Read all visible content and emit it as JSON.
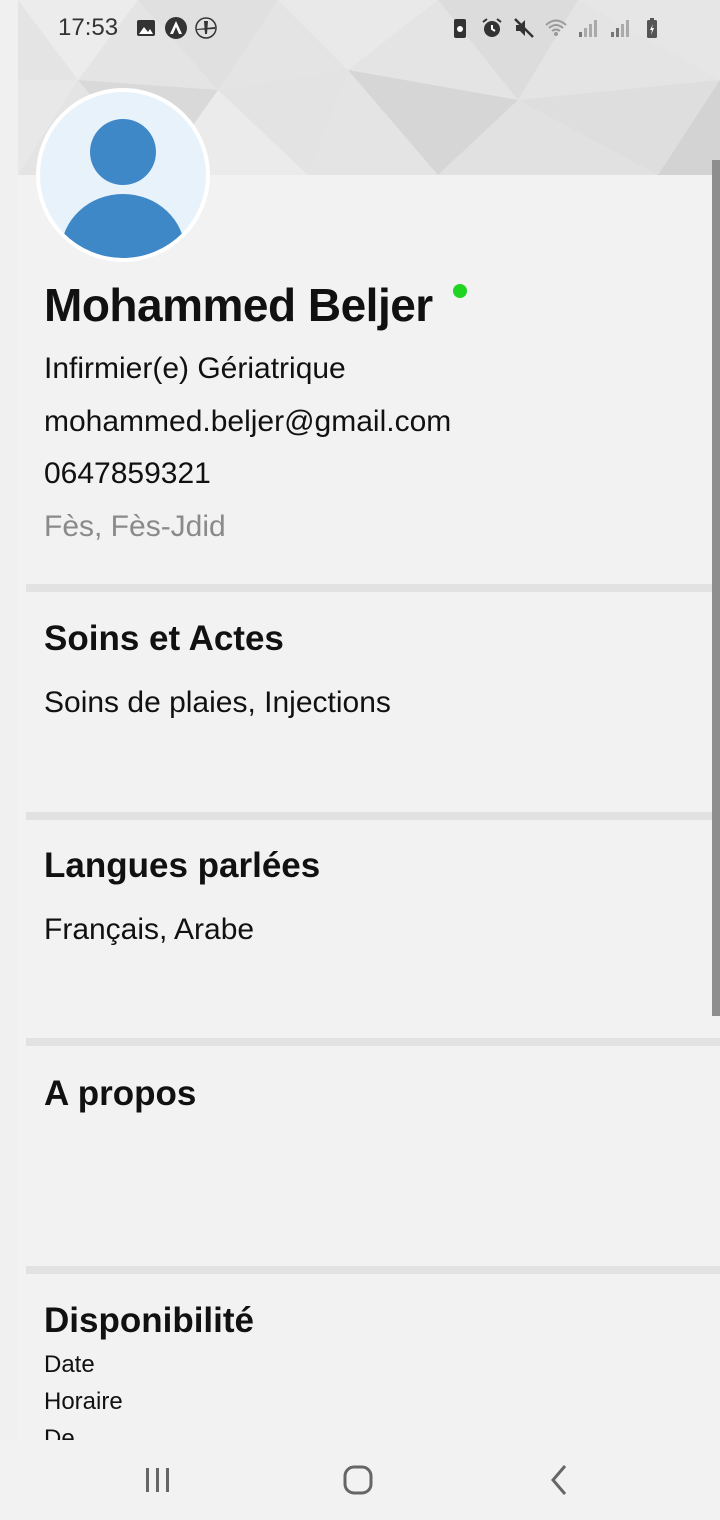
{
  "status_bar": {
    "time": "17:53",
    "left_icons": [
      "image-icon",
      "app-logo-icon",
      "airplane-app-icon"
    ],
    "right_icons": [
      "battery-saver-icon",
      "alarm-icon",
      "mute-icon",
      "wifi-icon",
      "signal-icon",
      "signal-icon",
      "battery-icon"
    ]
  },
  "profile": {
    "name": "Mohammed Beljer",
    "online": true,
    "role": "Infirmier(e) Gériatrique",
    "email": "mohammed.beljer@gmail.com",
    "phone": "0647859321",
    "location": "Fès, Fès-Jdid"
  },
  "sections": {
    "soins": {
      "title": "Soins et Actes",
      "text": "Soins de plaies, Injections"
    },
    "langues": {
      "title": "Langues parlées",
      "text": "Français, Arabe"
    },
    "apropos": {
      "title": "A propos",
      "text": ""
    },
    "disponibilite": {
      "title": "Disponibilité",
      "lines": [
        "Date",
        "Horaire",
        "De"
      ]
    }
  },
  "colors": {
    "online": "#22d422",
    "avatar_fill": "#3f88c8",
    "avatar_bg": "#e7f2fb"
  },
  "nav": [
    "recent-apps-button",
    "home-button",
    "back-button"
  ]
}
